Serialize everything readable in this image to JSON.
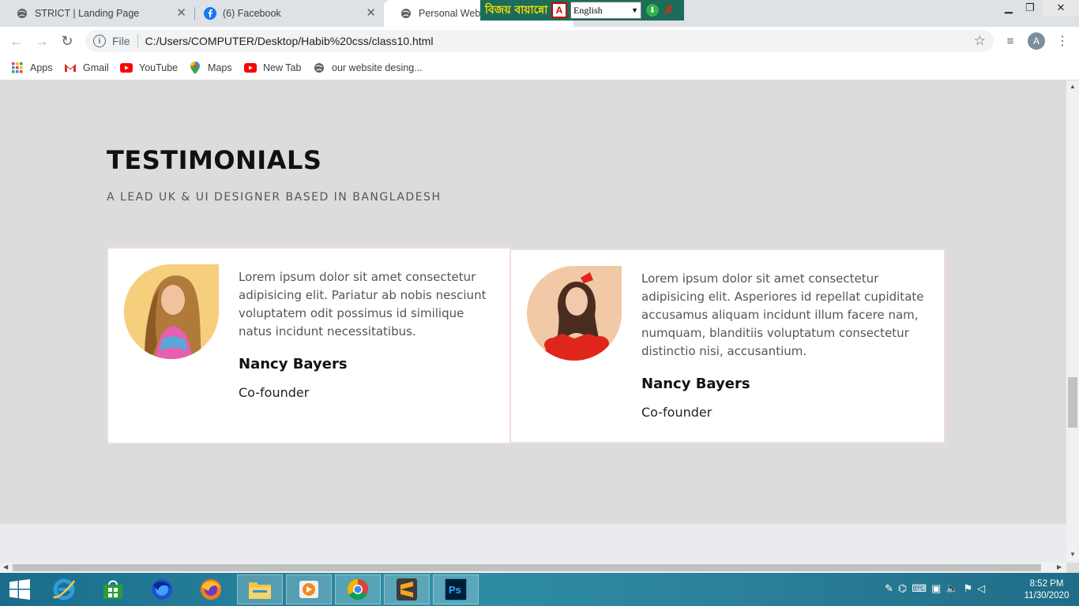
{
  "browser": {
    "tabs": [
      {
        "title": "STRICT | Landing Page",
        "icon": "globe-icon"
      },
      {
        "title": "(6) Facebook",
        "icon": "facebook-icon"
      },
      {
        "title": "Personal Websit",
        "icon": "globe-icon"
      }
    ],
    "address": {
      "scheme_label": "File",
      "url": "C:/Users/COMPUTER/Desktop/Habib%20css/class10.html"
    },
    "profile_initial": "A",
    "bookmarks": [
      {
        "label": "Apps",
        "icon": "apps-grid-icon"
      },
      {
        "label": "Gmail",
        "icon": "gmail-icon"
      },
      {
        "label": "YouTube",
        "icon": "youtube-icon"
      },
      {
        "label": "Maps",
        "icon": "maps-pin-icon"
      },
      {
        "label": "New Tab",
        "icon": "youtube-icon"
      },
      {
        "label": "our website desing...",
        "icon": "globe-icon"
      }
    ]
  },
  "overlay_toolbar": {
    "brand": "বিজয় বায়ান্নো",
    "language": "English"
  },
  "page": {
    "section_title": "TESTIMONIALS",
    "section_subtitle": "A LEAD UK & UI DESIGNER BASED IN BANGLADESH",
    "testimonials": [
      {
        "text": "Lorem ipsum dolor sit amet consectetur adipisicing elit. Pariatur ab nobis nesciunt voluptatem odit possimus id similique natus incidunt necessitatibus.",
        "name": "Nancy Bayers",
        "role": "Co-founder"
      },
      {
        "text": "Lorem ipsum dolor sit amet consectetur adipisicing elit. Asperiores id repellat cupiditate accusamus aliquam incidunt illum facere nam, numquam, blanditiis voluptatum consectetur distinctio nisi, accusantium.",
        "name": "Nancy Bayers",
        "role": "Co-founder"
      }
    ]
  },
  "taskbar": {
    "apps": [
      "internet-explorer-icon",
      "store-icon",
      "firefox-dev-icon",
      "firefox-icon",
      "file-explorer-icon",
      "media-player-icon",
      "chrome-icon",
      "sublime-text-icon",
      "photoshop-icon"
    ],
    "time": "8:52 PM",
    "date": "11/30/2020"
  },
  "colors": {
    "card_border": "#f3dcdc",
    "page_bg": "#dcdcdc",
    "accent_red": "#e0251b"
  }
}
